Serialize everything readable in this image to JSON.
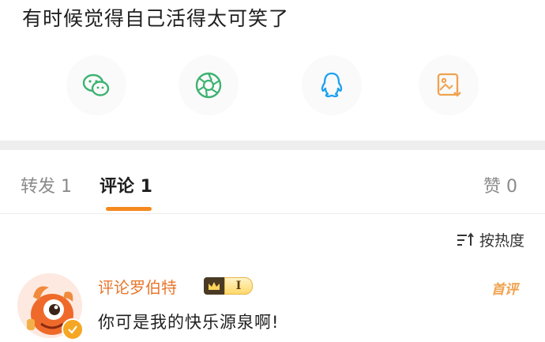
{
  "post": {
    "text": "有时候觉得自己活得太可笑了"
  },
  "share": {
    "items": [
      {
        "icon": "wechat-icon",
        "color": "#3cb371"
      },
      {
        "icon": "moments-icon",
        "color": "#3cb371"
      },
      {
        "icon": "qq-icon",
        "color": "#1da1f2"
      },
      {
        "icon": "save-image-icon",
        "color": "#f0a24e"
      }
    ]
  },
  "tabs": {
    "repost": "转发 1",
    "comments": "评论 1",
    "likes": "赞 0",
    "active": "comments",
    "accent_color": "#f5891f"
  },
  "sort": {
    "label": "按热度"
  },
  "comment": {
    "username": "评论罗伯特",
    "fan_level": "I",
    "first_tag": "首评",
    "text": "你可是我的快乐源泉啊!",
    "username_color": "#e8772e"
  }
}
